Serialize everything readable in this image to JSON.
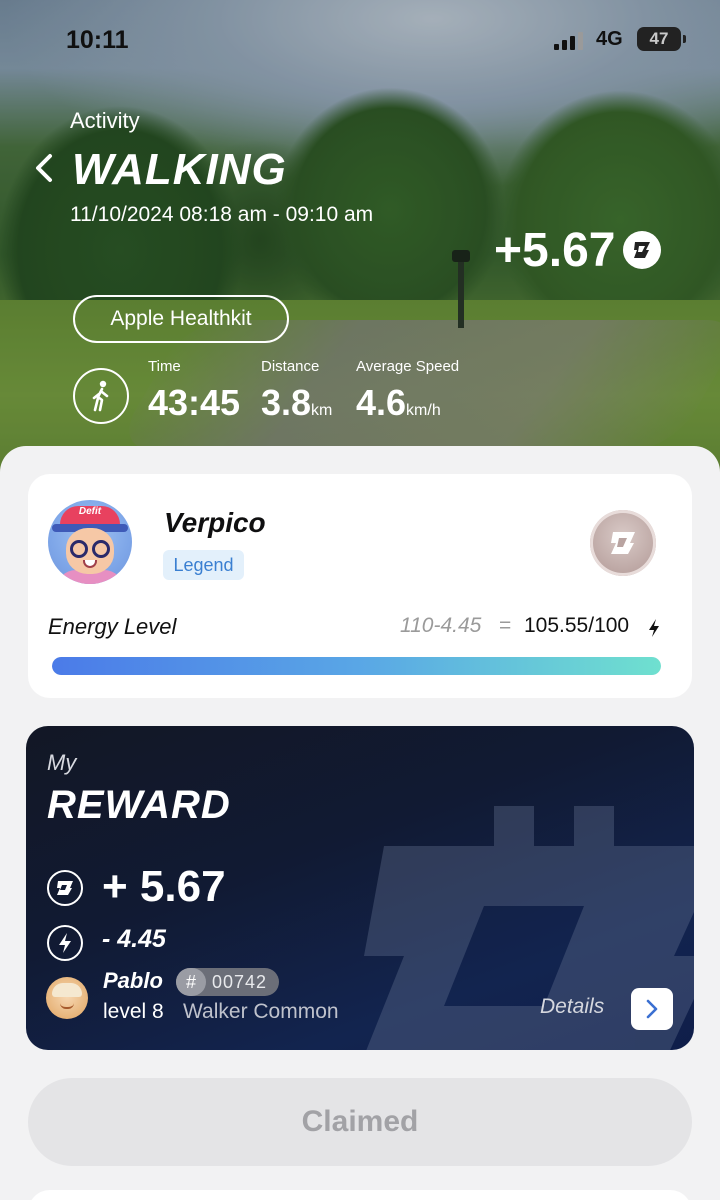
{
  "status_bar": {
    "time": "10:11",
    "network": "4G",
    "battery": "47"
  },
  "activity": {
    "label": "Activity",
    "title": "WALKING",
    "datetime": "11/10/2024 08:18 am - 09:10 am",
    "earned": "+5.67",
    "source": "Apple Healthkit",
    "stats": [
      {
        "label": "Time",
        "value": "43:45",
        "unit": ""
      },
      {
        "label": "Distance",
        "value": "3.8",
        "unit": "km"
      },
      {
        "label": "Average Speed",
        "value": "4.6",
        "unit": "km/h"
      }
    ]
  },
  "profile": {
    "avatar_word": "Defit",
    "name": "Verpico",
    "rank": "Legend",
    "energy_label": "Energy Level",
    "energy_calc": "110-4.45",
    "energy_eq": "=",
    "energy_value": "105.55/100",
    "energy_fill_fraction": 1.0
  },
  "reward": {
    "my_label": "My",
    "title": "REWARD",
    "plus_value": "+ 5.67",
    "minus_value": "- 4.45",
    "shoe_name": "Pablo",
    "shoe_hash": "#",
    "shoe_id": "00742",
    "shoe_level": "level 8",
    "shoe_class": "Walker Common",
    "details_label": "Details"
  },
  "claim_button": "Claimed",
  "colors": {
    "energy_start": "#4b7be8",
    "energy_end": "#6fe0cf",
    "rank_text": "#3a7fd1",
    "reward_bg": "#12244f"
  }
}
